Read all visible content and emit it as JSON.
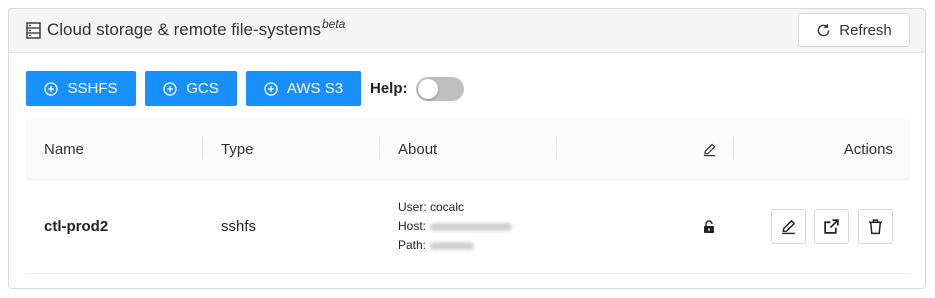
{
  "header": {
    "title": "Cloud storage & remote file-systems",
    "title_sup": "beta",
    "refresh_label": "Refresh"
  },
  "toolbar": {
    "buttons": [
      {
        "label": "SSHFS"
      },
      {
        "label": "GCS"
      },
      {
        "label": "AWS S3"
      }
    ],
    "help_label": "Help:",
    "help_enabled": false
  },
  "table": {
    "columns": {
      "name": "Name",
      "type": "Type",
      "about": "About",
      "actions": "Actions"
    },
    "rows": [
      {
        "name": "ctl-prod2",
        "type": "sshfs",
        "about": {
          "user": "User: cocalc",
          "host_label": "Host:",
          "path_label": "Path:"
        },
        "lock_state": "unlocked"
      }
    ]
  },
  "colors": {
    "primary": "#1890ff",
    "toggle_off": "#bfbfbf",
    "header_bg": "#f5f5f5"
  }
}
